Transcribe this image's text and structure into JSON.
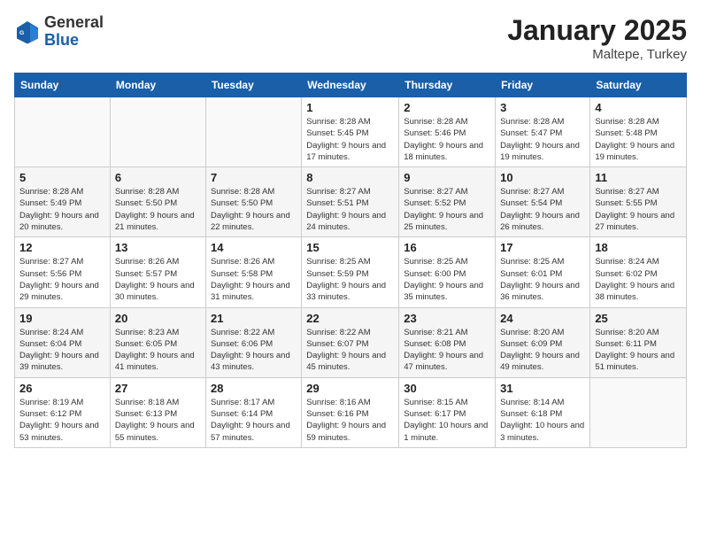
{
  "header": {
    "logo_general": "General",
    "logo_blue": "Blue",
    "month_year": "January 2025",
    "location": "Maltepe, Turkey"
  },
  "weekdays": [
    "Sunday",
    "Monday",
    "Tuesday",
    "Wednesday",
    "Thursday",
    "Friday",
    "Saturday"
  ],
  "weeks": [
    [
      {
        "day": "",
        "info": ""
      },
      {
        "day": "",
        "info": ""
      },
      {
        "day": "",
        "info": ""
      },
      {
        "day": "1",
        "info": "Sunrise: 8:28 AM\nSunset: 5:45 PM\nDaylight: 9 hours and 17 minutes."
      },
      {
        "day": "2",
        "info": "Sunrise: 8:28 AM\nSunset: 5:46 PM\nDaylight: 9 hours and 18 minutes."
      },
      {
        "day": "3",
        "info": "Sunrise: 8:28 AM\nSunset: 5:47 PM\nDaylight: 9 hours and 19 minutes."
      },
      {
        "day": "4",
        "info": "Sunrise: 8:28 AM\nSunset: 5:48 PM\nDaylight: 9 hours and 19 minutes."
      }
    ],
    [
      {
        "day": "5",
        "info": "Sunrise: 8:28 AM\nSunset: 5:49 PM\nDaylight: 9 hours and 20 minutes."
      },
      {
        "day": "6",
        "info": "Sunrise: 8:28 AM\nSunset: 5:50 PM\nDaylight: 9 hours and 21 minutes."
      },
      {
        "day": "7",
        "info": "Sunrise: 8:28 AM\nSunset: 5:50 PM\nDaylight: 9 hours and 22 minutes."
      },
      {
        "day": "8",
        "info": "Sunrise: 8:27 AM\nSunset: 5:51 PM\nDaylight: 9 hours and 24 minutes."
      },
      {
        "day": "9",
        "info": "Sunrise: 8:27 AM\nSunset: 5:52 PM\nDaylight: 9 hours and 25 minutes."
      },
      {
        "day": "10",
        "info": "Sunrise: 8:27 AM\nSunset: 5:54 PM\nDaylight: 9 hours and 26 minutes."
      },
      {
        "day": "11",
        "info": "Sunrise: 8:27 AM\nSunset: 5:55 PM\nDaylight: 9 hours and 27 minutes."
      }
    ],
    [
      {
        "day": "12",
        "info": "Sunrise: 8:27 AM\nSunset: 5:56 PM\nDaylight: 9 hours and 29 minutes."
      },
      {
        "day": "13",
        "info": "Sunrise: 8:26 AM\nSunset: 5:57 PM\nDaylight: 9 hours and 30 minutes."
      },
      {
        "day": "14",
        "info": "Sunrise: 8:26 AM\nSunset: 5:58 PM\nDaylight: 9 hours and 31 minutes."
      },
      {
        "day": "15",
        "info": "Sunrise: 8:25 AM\nSunset: 5:59 PM\nDaylight: 9 hours and 33 minutes."
      },
      {
        "day": "16",
        "info": "Sunrise: 8:25 AM\nSunset: 6:00 PM\nDaylight: 9 hours and 35 minutes."
      },
      {
        "day": "17",
        "info": "Sunrise: 8:25 AM\nSunset: 6:01 PM\nDaylight: 9 hours and 36 minutes."
      },
      {
        "day": "18",
        "info": "Sunrise: 8:24 AM\nSunset: 6:02 PM\nDaylight: 9 hours and 38 minutes."
      }
    ],
    [
      {
        "day": "19",
        "info": "Sunrise: 8:24 AM\nSunset: 6:04 PM\nDaylight: 9 hours and 39 minutes."
      },
      {
        "day": "20",
        "info": "Sunrise: 8:23 AM\nSunset: 6:05 PM\nDaylight: 9 hours and 41 minutes."
      },
      {
        "day": "21",
        "info": "Sunrise: 8:22 AM\nSunset: 6:06 PM\nDaylight: 9 hours and 43 minutes."
      },
      {
        "day": "22",
        "info": "Sunrise: 8:22 AM\nSunset: 6:07 PM\nDaylight: 9 hours and 45 minutes."
      },
      {
        "day": "23",
        "info": "Sunrise: 8:21 AM\nSunset: 6:08 PM\nDaylight: 9 hours and 47 minutes."
      },
      {
        "day": "24",
        "info": "Sunrise: 8:20 AM\nSunset: 6:09 PM\nDaylight: 9 hours and 49 minutes."
      },
      {
        "day": "25",
        "info": "Sunrise: 8:20 AM\nSunset: 6:11 PM\nDaylight: 9 hours and 51 minutes."
      }
    ],
    [
      {
        "day": "26",
        "info": "Sunrise: 8:19 AM\nSunset: 6:12 PM\nDaylight: 9 hours and 53 minutes."
      },
      {
        "day": "27",
        "info": "Sunrise: 8:18 AM\nSunset: 6:13 PM\nDaylight: 9 hours and 55 minutes."
      },
      {
        "day": "28",
        "info": "Sunrise: 8:17 AM\nSunset: 6:14 PM\nDaylight: 9 hours and 57 minutes."
      },
      {
        "day": "29",
        "info": "Sunrise: 8:16 AM\nSunset: 6:16 PM\nDaylight: 9 hours and 59 minutes."
      },
      {
        "day": "30",
        "info": "Sunrise: 8:15 AM\nSunset: 6:17 PM\nDaylight: 10 hours and 1 minute."
      },
      {
        "day": "31",
        "info": "Sunrise: 8:14 AM\nSunset: 6:18 PM\nDaylight: 10 hours and 3 minutes."
      },
      {
        "day": "",
        "info": ""
      }
    ]
  ]
}
